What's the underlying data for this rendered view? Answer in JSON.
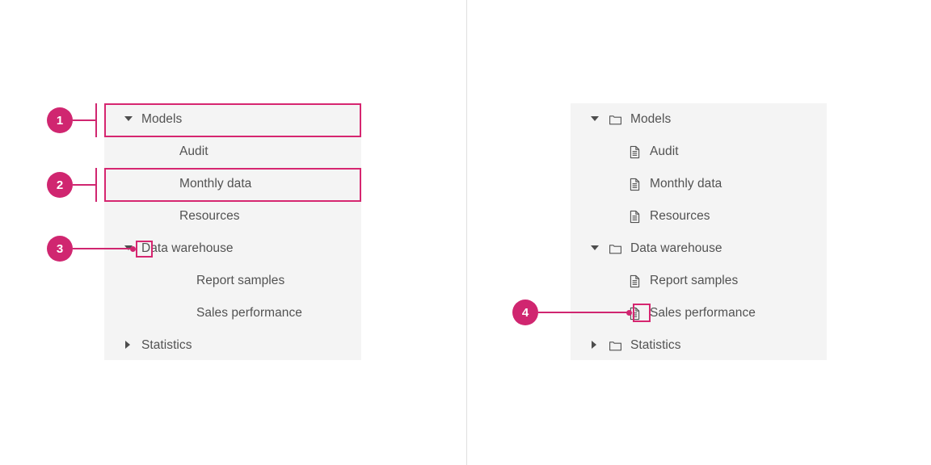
{
  "annotation": {
    "accent_color": "#d02670",
    "highlight_color": "#d62670",
    "panel_background": "#f4f4f4",
    "text_color": "#525252",
    "divider_color": "#e0e0e0",
    "callouts": [
      {
        "number": "1",
        "target": "models-row-left"
      },
      {
        "number": "2",
        "target": "monthly-data-row-left"
      },
      {
        "number": "3",
        "target": "data-warehouse-caret-left"
      },
      {
        "number": "4",
        "target": "sales-performance-icon-right"
      }
    ]
  },
  "left_tree": {
    "rows": [
      {
        "label": "Models",
        "indent": 0,
        "caret": "expanded",
        "icon": "none"
      },
      {
        "label": "Audit",
        "indent": 1,
        "caret": "none",
        "icon": "none"
      },
      {
        "label": "Monthly data",
        "indent": 1,
        "caret": "none",
        "icon": "none"
      },
      {
        "label": "Resources",
        "indent": 1,
        "caret": "none",
        "icon": "none"
      },
      {
        "label": "Data warehouse",
        "indent": 0,
        "caret": "expanded",
        "icon": "none"
      },
      {
        "label": "Report samples",
        "indent": 2,
        "caret": "none",
        "icon": "none"
      },
      {
        "label": "Sales performance",
        "indent": 2,
        "caret": "none",
        "icon": "none"
      },
      {
        "label": "Statistics",
        "indent": 0,
        "caret": "collapsed",
        "icon": "none"
      }
    ]
  },
  "right_tree": {
    "rows": [
      {
        "label": "Models",
        "indent": 0,
        "caret": "expanded",
        "icon": "folder-icon"
      },
      {
        "label": "Audit",
        "indent": 1,
        "caret": "none",
        "icon": "document-icon"
      },
      {
        "label": "Monthly data",
        "indent": 1,
        "caret": "none",
        "icon": "document-icon"
      },
      {
        "label": "Resources",
        "indent": 1,
        "caret": "none",
        "icon": "document-icon"
      },
      {
        "label": "Data warehouse",
        "indent": 0,
        "caret": "expanded",
        "icon": "folder-icon"
      },
      {
        "label": "Report samples",
        "indent": 1,
        "caret": "none",
        "icon": "document-icon"
      },
      {
        "label": "Sales performance",
        "indent": 1,
        "caret": "none",
        "icon": "document-icon"
      },
      {
        "label": "Statistics",
        "indent": 0,
        "caret": "collapsed",
        "icon": "folder-icon"
      }
    ]
  }
}
